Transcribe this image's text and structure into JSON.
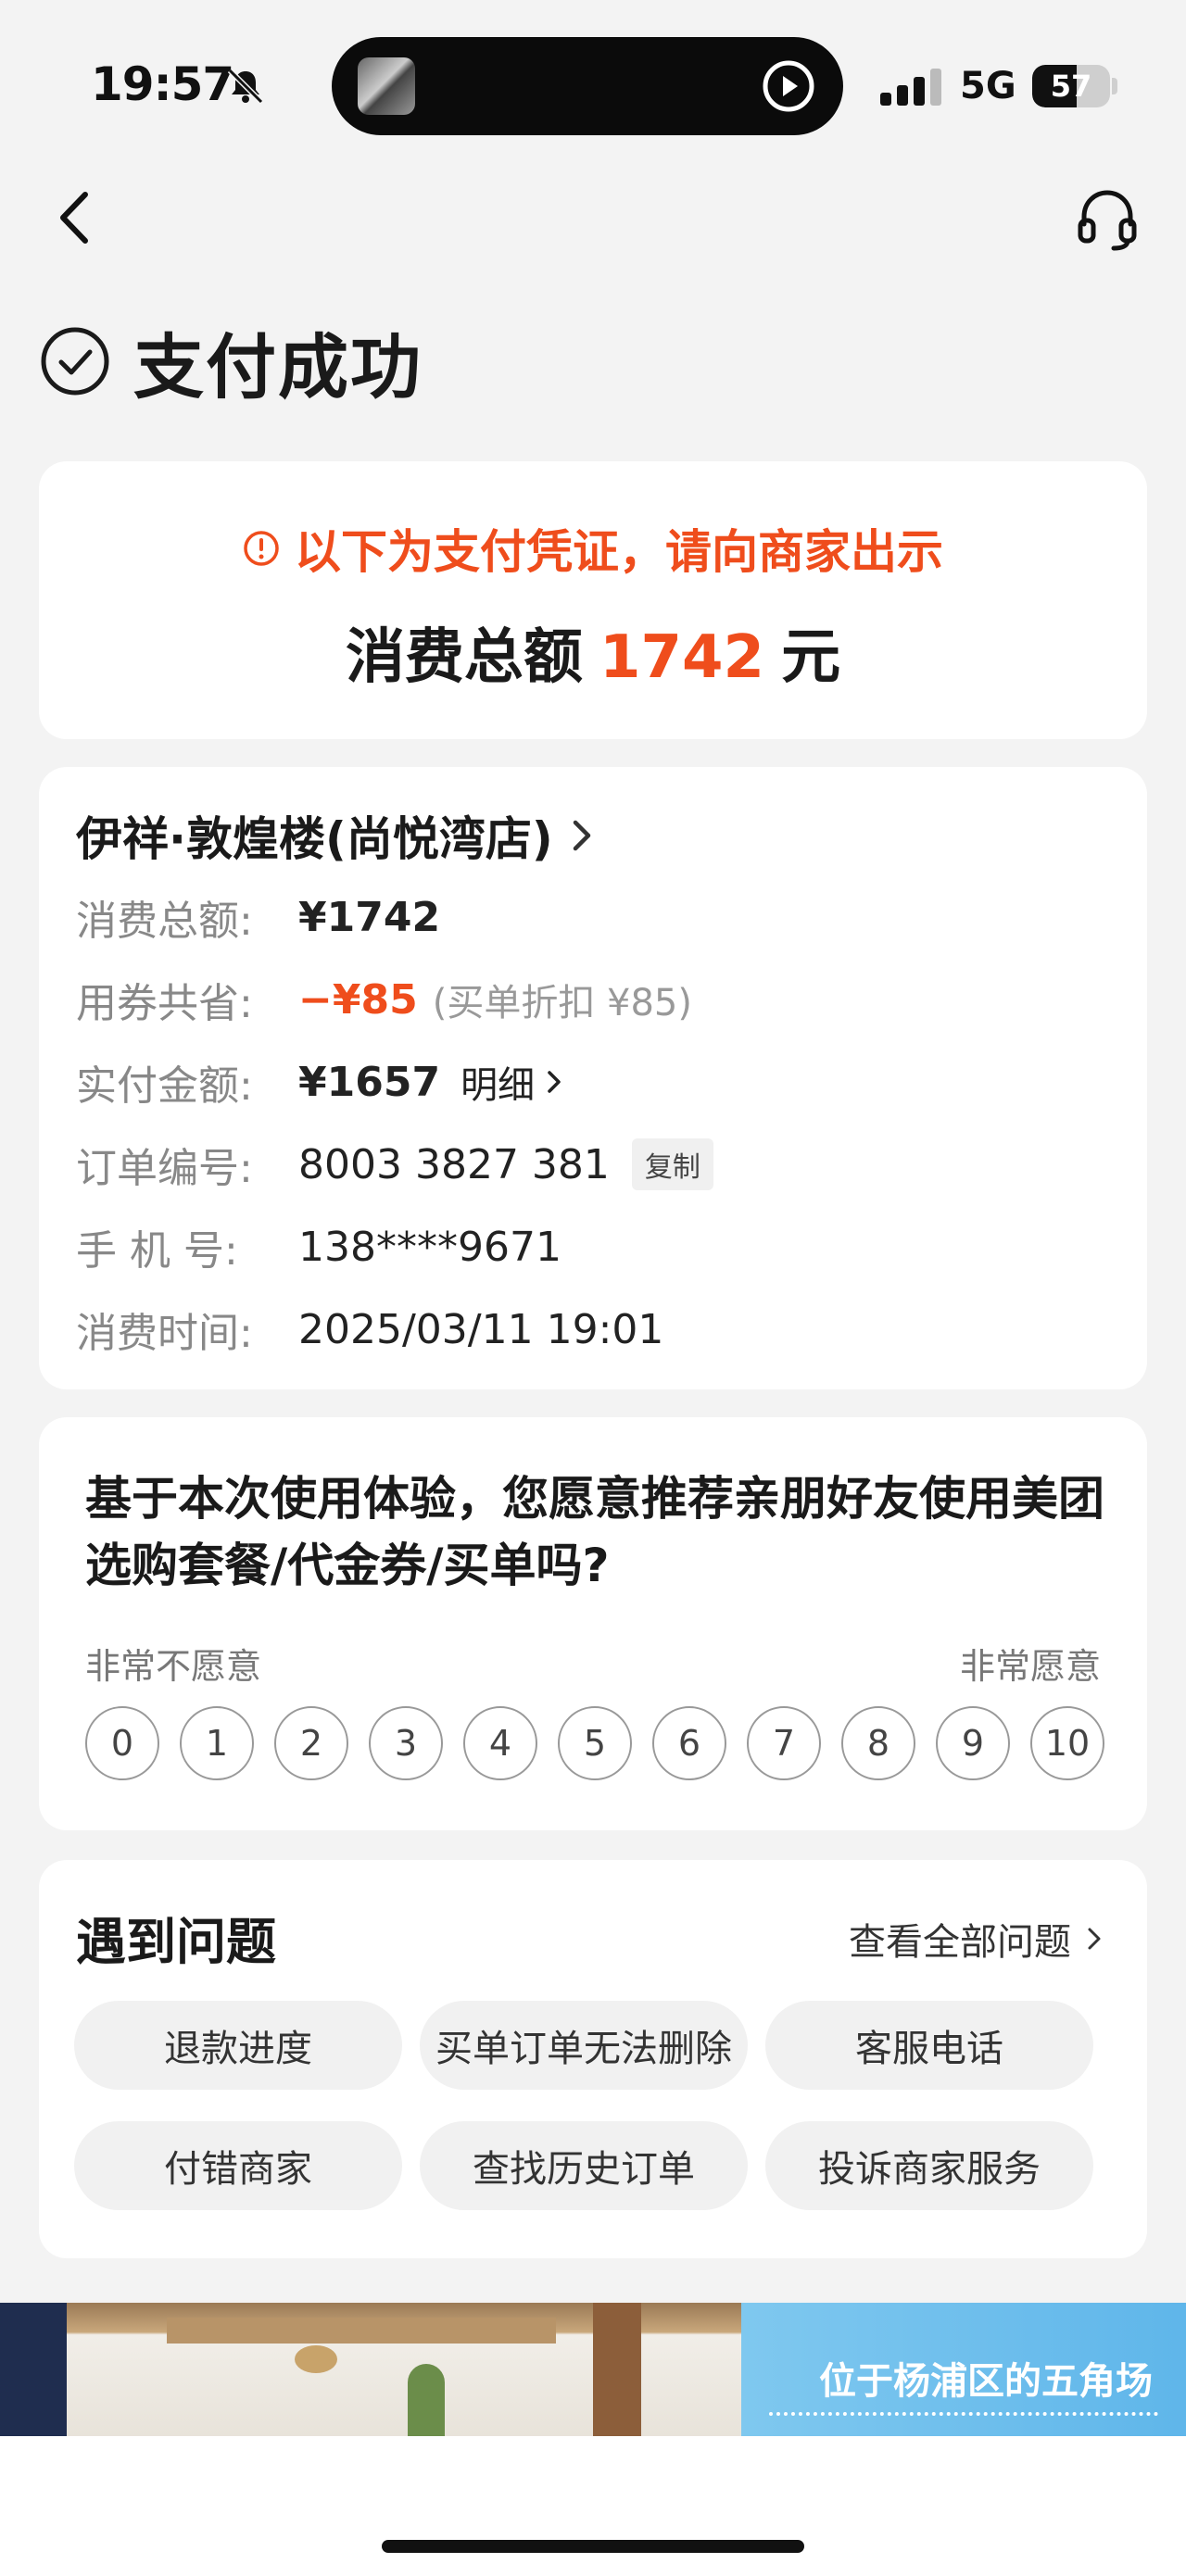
{
  "status_bar": {
    "time": "19:57",
    "network": "5G",
    "battery": "57",
    "battery_level": 0.57
  },
  "page": {
    "title": "支付成功"
  },
  "voucher": {
    "notice": "以下为支付凭证，请向商家出示",
    "total_label": "消费总额",
    "total_amount": "1742",
    "total_unit": "元"
  },
  "order": {
    "store_name": "伊祥·敦煌楼(尚悦湾店)",
    "rows": {
      "total": {
        "label": "消费总额:",
        "value": "¥1742"
      },
      "saved": {
        "label": "用券共省:",
        "value": "−¥85",
        "note": "(买单折扣 ¥85)"
      },
      "paid": {
        "label": "实付金额:",
        "value": "¥1657",
        "link": "明细"
      },
      "order_no": {
        "label": "订单编号:",
        "value": "8003 3827 381",
        "action": "复制"
      },
      "phone": {
        "label": "手 机 号:",
        "value": "138****9671"
      },
      "time": {
        "label": "消费时间:",
        "value": "2025/03/11 19:01"
      }
    }
  },
  "survey": {
    "question": "基于本次使用体验，您愿意推荐亲朋好友使用美团选购套餐/代金券/买单吗?",
    "low_label": "非常不愿意",
    "high_label": "非常愿意",
    "options": [
      "0",
      "1",
      "2",
      "3",
      "4",
      "5",
      "6",
      "7",
      "8",
      "9",
      "10"
    ]
  },
  "problems": {
    "title": "遇到问题",
    "view_all": "查看全部问题",
    "items": [
      "退款进度",
      "买单订单无法删除",
      "客服电话",
      "付错商家",
      "查找历史订单",
      "投诉商家服务"
    ]
  },
  "banner": {
    "text": "位于杨浦区的五角场"
  },
  "colors": {
    "accent": "#ef4d1c",
    "background": "#f3f3f3"
  },
  "icons": [
    "bell-slash-icon",
    "play-icon",
    "signal-icon",
    "battery-icon",
    "back-icon",
    "headset-icon",
    "check-circle-icon",
    "alert-icon",
    "chevron-right-icon"
  ]
}
